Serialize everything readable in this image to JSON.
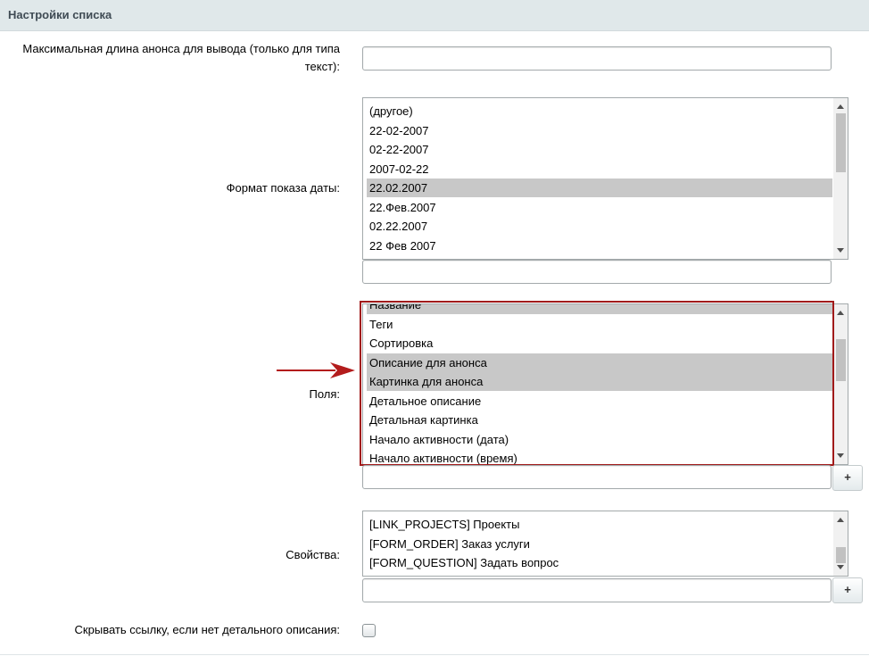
{
  "section": {
    "title": "Настройки списка"
  },
  "max_length": {
    "label": "Максимальная длина анонса для вывода (только для типа текст):",
    "value": ""
  },
  "date_format": {
    "label": "Формат показа даты:",
    "options": [
      "(другое)",
      "22-02-2007",
      "02-22-2007",
      "2007-02-22",
      "22.02.2007",
      "22.Фев.2007",
      "02.22.2007",
      "22 Фев 2007"
    ],
    "selected": [
      4
    ],
    "custom_value": "",
    "scroll_position": 0.0
  },
  "fields": {
    "label": "Поля:",
    "options": [
      "Название",
      "Теги",
      "Сортировка",
      "Описание для анонса",
      "Картинка для анонса",
      "Детальное описание",
      "Детальная картинка",
      "Начало активности (дата)",
      "Начало активности (время)"
    ],
    "selected": [
      0,
      3,
      4
    ],
    "value": "",
    "add_label": "+",
    "highlight_color": "#a11a1a"
  },
  "properties": {
    "label": "Свойства:",
    "options": [
      "[LINK_PROJECTS] Проекты",
      "[FORM_ORDER] Заказ услуги",
      "[FORM_QUESTION] Задать вопрос"
    ],
    "selected": [],
    "value": "",
    "add_label": "+"
  },
  "hide_link": {
    "label": "Скрывать ссылку, если нет детального описания:",
    "checked": false
  }
}
